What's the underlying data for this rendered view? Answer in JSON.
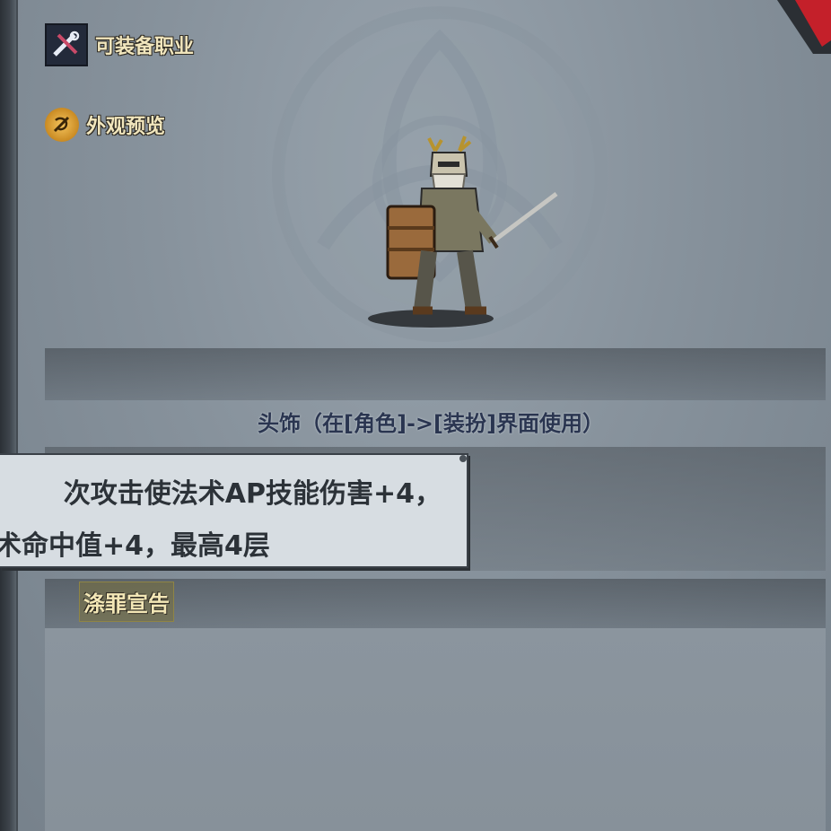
{
  "labels": {
    "equip_class": "可装备职业",
    "appearance_preview": "外观预览"
  },
  "item": {
    "type_line": "头饰（在[角色]->[装扮]界面使用）"
  },
  "tooltip": {
    "line1": "次攻击使法术AP技能伤害+4，",
    "line2": "术命中值+4，最高4层"
  },
  "skill": {
    "name": "涤罪宣告"
  },
  "icons": {
    "job": "crossed-tools-icon",
    "preview": "eye-swirl-icon",
    "close": "close-icon"
  },
  "colors": {
    "label_gold": "#f1e6bd",
    "item_type_blue": "#2a3550",
    "close_red": "#c4202a"
  }
}
